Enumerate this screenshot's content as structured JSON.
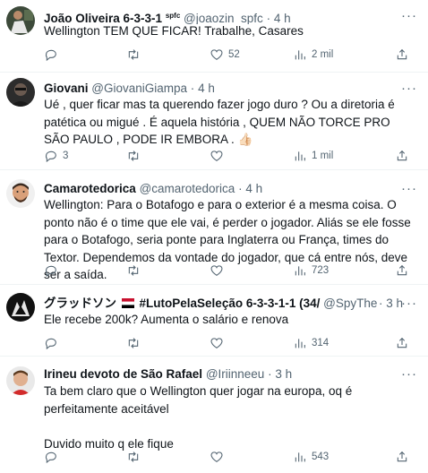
{
  "tweets": [
    {
      "name": "João Oliveira 6-3-3-1",
      "name_suffix": "spfc",
      "handle": "@joaozin_spfc",
      "dot": "·",
      "time": "4 h",
      "more": "···",
      "text": "Wellington TEM QUE FICAR! Trabalhe, Casares",
      "replies": "",
      "retweets": "",
      "likes": "52",
      "views": "2 mil"
    },
    {
      "name": "Giovani",
      "handle": "@GiovaniGiampa",
      "dot": "·",
      "time": "4 h",
      "more": "···",
      "text": "Ué , quer ficar mas ta querendo fazer jogo duro ? Ou a diretoria é patética ou migué . É aquela história , QUEM NÃO TORCE PRO SÃO PAULO , PODE IR EMBORA . 👍🏻",
      "replies": "3",
      "retweets": "",
      "likes": "",
      "views": "1 mil"
    },
    {
      "name": "Camarotedorica",
      "handle": "@camarotedorica",
      "dot": "·",
      "time": "4 h",
      "more": "···",
      "text": "Wellington: Para o Botafogo e para o exterior é a mesma coisa. O ponto não é o time que ele vai, é perder o jogador. Aliás se ele fosse para o Botafogo, seria ponte para Inglaterra ou França, times do Textor. Dependemos da vontade do jogador, que cá entre nós, deve ser a saída.",
      "replies": "",
      "retweets": "",
      "likes": "",
      "views": "723"
    },
    {
      "name": "グラッドソン",
      "name_tag": "#LutoPelaSeleção 6-3-3-1-1 (34/",
      "handle": "@SpyTheBeas",
      "dot": "·",
      "time": "3 h",
      "more": "···",
      "text": "Ele recebe 200k? Aumenta o salário e renova",
      "replies": "",
      "retweets": "",
      "likes": "",
      "views": "314"
    },
    {
      "name": "Irineu devoto de São Rafael",
      "handle": "@Iriinneeu",
      "dot": "·",
      "time": "3 h",
      "more": "···",
      "text": "Ta bem claro que o Wellington quer jogar na europa, oq é perfeitamente aceitável\n\nDuvido muito q ele fique",
      "replies": "",
      "retweets": "",
      "likes": "",
      "views": "543"
    }
  ],
  "icons": {
    "reply": "reply-icon",
    "retweet": "retweet-icon",
    "like": "heart-icon",
    "views": "views-icon",
    "share": "share-icon"
  },
  "colors": {
    "text": "#0f1419",
    "muted": "#536471",
    "divider": "#eff3f4",
    "flag_red": "#c8102e",
    "flag_black": "#000000"
  }
}
